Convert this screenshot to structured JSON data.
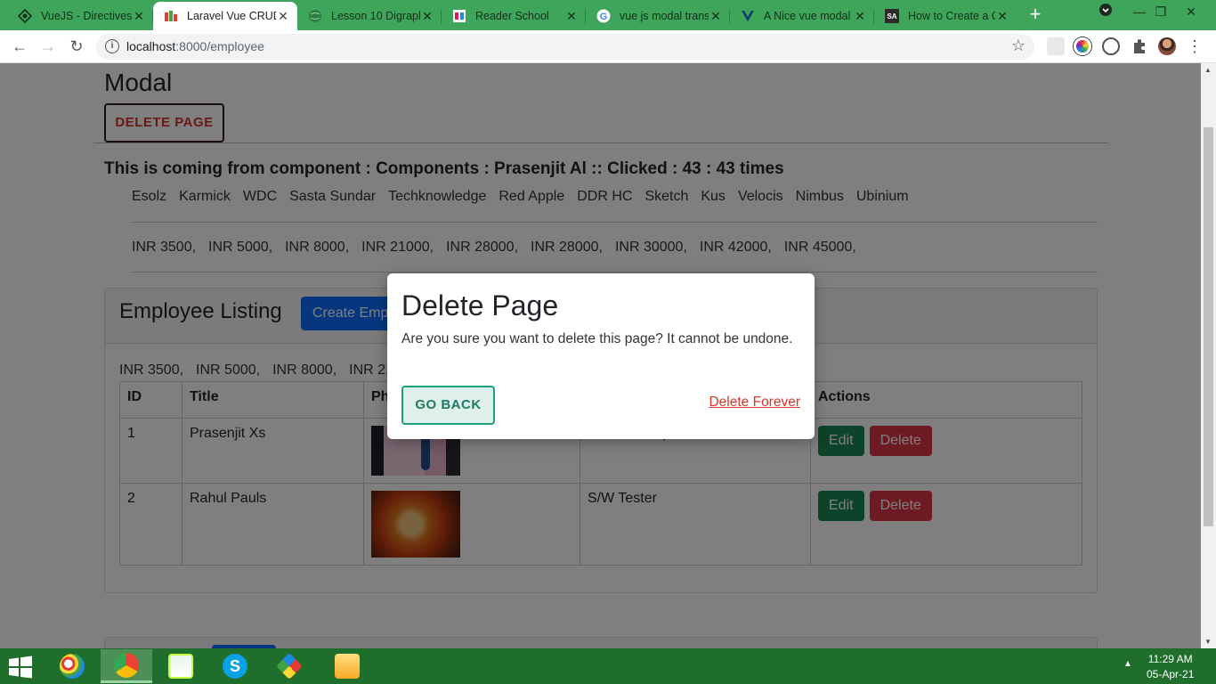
{
  "browser": {
    "tabs": [
      {
        "title": "VueJS - Directives",
        "icon": "vuejs-tutorial-icon",
        "active": false
      },
      {
        "title": "Laravel Vue CRUD",
        "icon": "laravel-vue-icon",
        "active": true
      },
      {
        "title": "Lesson 10 Digraph",
        "icon": "globe-icon",
        "active": false
      },
      {
        "title": "Reader School",
        "icon": "reader-school-icon",
        "active": false
      },
      {
        "title": "vue js modal trans",
        "icon": "google-icon",
        "active": false
      },
      {
        "title": "A Nice vue modal",
        "icon": "vue-icon",
        "active": false
      },
      {
        "title": "How to Create a C",
        "icon": "sa-icon",
        "active": false
      }
    ],
    "new_tab": "+",
    "address": {
      "host": "localhost",
      "port": ":8000",
      "path": "/employee"
    }
  },
  "page": {
    "heading": "Modal",
    "delete_page_button": "DELETE PAGE",
    "component_line": "This is coming from component : Components : Prasenjit Al :: Clicked : 43 : 43 times",
    "companies": [
      "Esolz",
      "Karmick",
      "WDC",
      "Sasta Sundar",
      "Techknowledge",
      "Red Apple",
      "DDR HC",
      "Sketch",
      "Kus",
      "Velocis",
      "Nimbus",
      "Ubinium"
    ],
    "salaries": [
      "INR 3500,",
      "INR 5000,",
      "INR 8000,",
      "INR 21000,",
      "INR 28000,",
      "INR 28000,",
      "INR 30000,",
      "INR 42000,",
      "INR 45000,"
    ],
    "listing": {
      "title": "Employee Listing",
      "create_button": "Create Emp...",
      "salaries_visible": [
        "INR 3500,",
        "INR 5000,",
        "INR 8000,",
        "INR 210"
      ],
      "columns": [
        "ID",
        "Title",
        "Ph",
        "",
        "Actions"
      ],
      "rows": [
        {
          "id": "1",
          "title": "Prasenjit Xs",
          "designation": "S/W Developer"
        },
        {
          "id": "2",
          "title": "Rahul Pauls",
          "designation": "S/W Tester"
        }
      ],
      "edit_label": "Edit",
      "delete_label": "Delete"
    }
  },
  "modal": {
    "title": "Delete Page",
    "body": "Are you sure you want to delete this page? It cannot be undone.",
    "go_back": "GO BACK",
    "delete_forever": "Delete Forever"
  },
  "taskbar": {
    "time": "11:29 AM",
    "date": "05-Apr-21",
    "apps": [
      "paint-icon",
      "chrome-icon",
      "notepad-icon",
      "skype-icon",
      "app-icon",
      "file-explorer-icon"
    ]
  },
  "colors": {
    "tabstrip": "#3fa55a",
    "taskbar": "#1f6e2c",
    "modal_accent": "#19a07c",
    "danger": "#d33a2c"
  }
}
